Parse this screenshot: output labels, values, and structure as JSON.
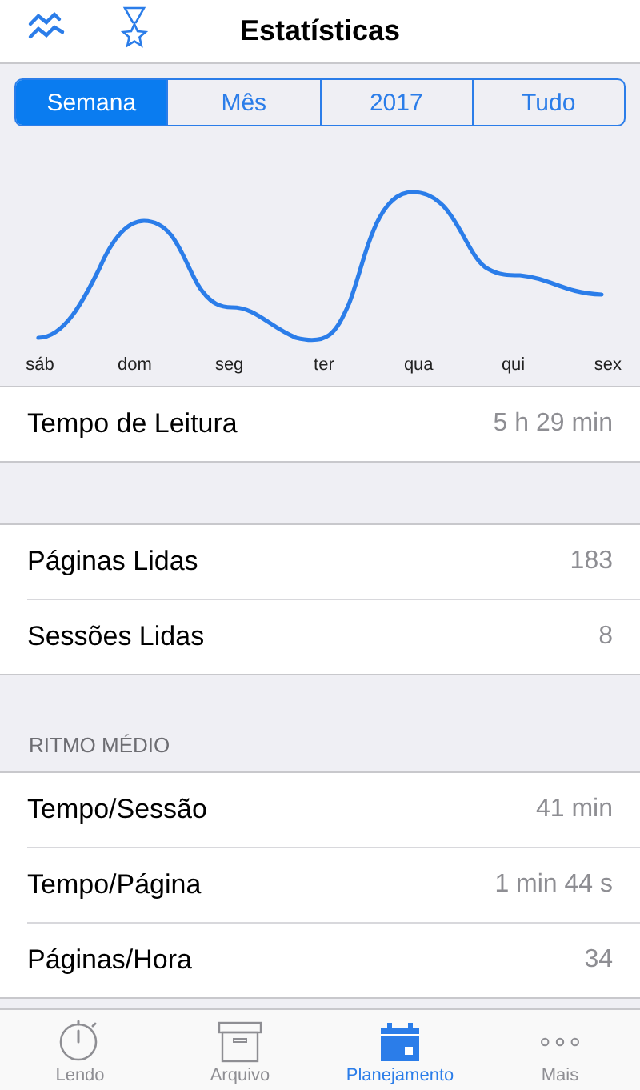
{
  "header": {
    "title": "Estatísticas"
  },
  "segments": [
    {
      "label": "Semana",
      "selected": true
    },
    {
      "label": "Mês",
      "selected": false
    },
    {
      "label": "2017",
      "selected": false
    },
    {
      "label": "Tudo",
      "selected": false
    }
  ],
  "chart": {
    "days": [
      "sáb",
      "dom",
      "seg",
      "ter",
      "qua",
      "qui",
      "sex"
    ]
  },
  "groups": [
    {
      "rows": [
        {
          "label": "Tempo de Leitura",
          "value": "5 h 29 min"
        }
      ]
    },
    {
      "rows": [
        {
          "label": "Páginas Lidas",
          "value": "183"
        },
        {
          "label": "Sessões Lidas",
          "value": "8"
        }
      ]
    },
    {
      "header": "RITMO MÉDIO",
      "rows": [
        {
          "label": "Tempo/Sessão",
          "value": "41 min"
        },
        {
          "label": "Tempo/Página",
          "value": "1 min 44 s"
        },
        {
          "label": "Páginas/Hora",
          "value": "34"
        }
      ]
    }
  ],
  "tabbar": [
    {
      "kind": "stopwatch",
      "label": "Lendo",
      "selected": false
    },
    {
      "kind": "archive",
      "label": "Arquivo",
      "selected": false
    },
    {
      "kind": "calendar",
      "label": "Planejamento",
      "selected": true
    },
    {
      "kind": "more",
      "label": "Mais",
      "selected": false
    }
  ]
}
